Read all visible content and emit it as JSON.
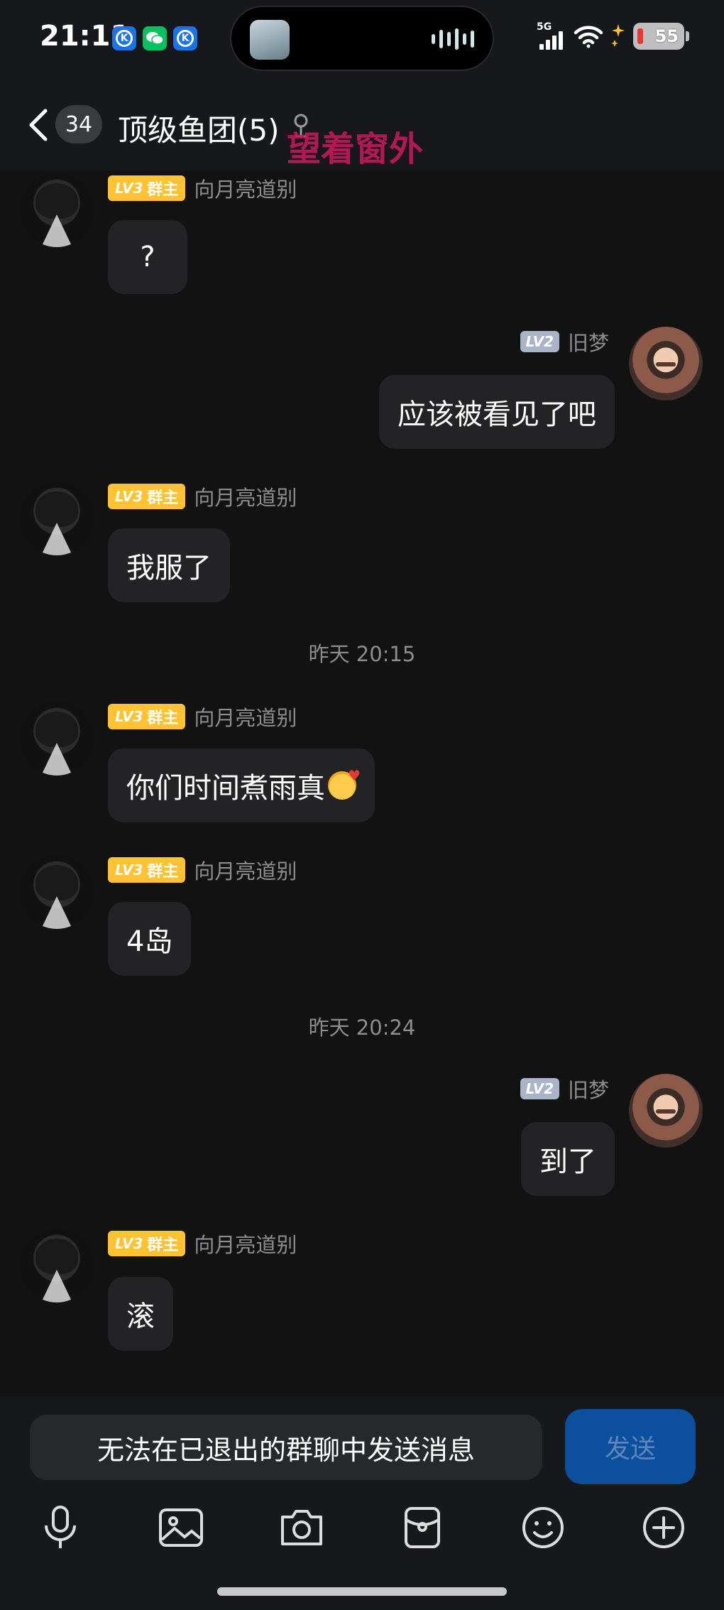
{
  "status_bar": {
    "time": "21:11",
    "network": "5G",
    "battery": "55",
    "notification_icons": [
      "k-app-icon",
      "wechat-icon",
      "k-app-icon"
    ]
  },
  "header": {
    "unread_count": "34",
    "title": "顶级鱼团(5)",
    "watermark": "望着窗外"
  },
  "messages": [
    {
      "from": "other",
      "level": "LV3",
      "role": "群主",
      "nick": "向月亮道别",
      "text": "?"
    },
    {
      "from": "me",
      "level": "LV2",
      "nick": "旧梦",
      "text": "应该被看见了吧"
    },
    {
      "from": "other",
      "level": "LV3",
      "role": "群主",
      "nick": "向月亮道别",
      "text": "我服了"
    },
    {
      "timestamp": "昨天 20:15"
    },
    {
      "from": "other",
      "level": "LV3",
      "role": "群主",
      "nick": "向月亮道别",
      "text": "你们时间煮雨真",
      "emoji": "smiling-face-with-hearts"
    },
    {
      "from": "other",
      "level": "LV3",
      "role": "群主",
      "nick": "向月亮道别",
      "text": "4岛"
    },
    {
      "timestamp": "昨天 20:24"
    },
    {
      "from": "me",
      "level": "LV2",
      "nick": "旧梦",
      "text": "到了"
    },
    {
      "from": "other",
      "level": "LV3",
      "role": "群主",
      "nick": "向月亮道别",
      "text": "滚"
    }
  ],
  "bottom": {
    "notice": "无法在已退出的群聊中发送消息",
    "send_label": "发送",
    "toolbar_icons": [
      "microphone-icon",
      "image-icon",
      "camera-icon",
      "red-packet-icon",
      "emoji-icon",
      "plus-icon"
    ]
  },
  "colors": {
    "background": "#121212",
    "bubble": "#232325",
    "lv3_badge": "#ffc233",
    "lv2_badge": "#a9b4c8",
    "send_button": "#0c4f9e"
  }
}
